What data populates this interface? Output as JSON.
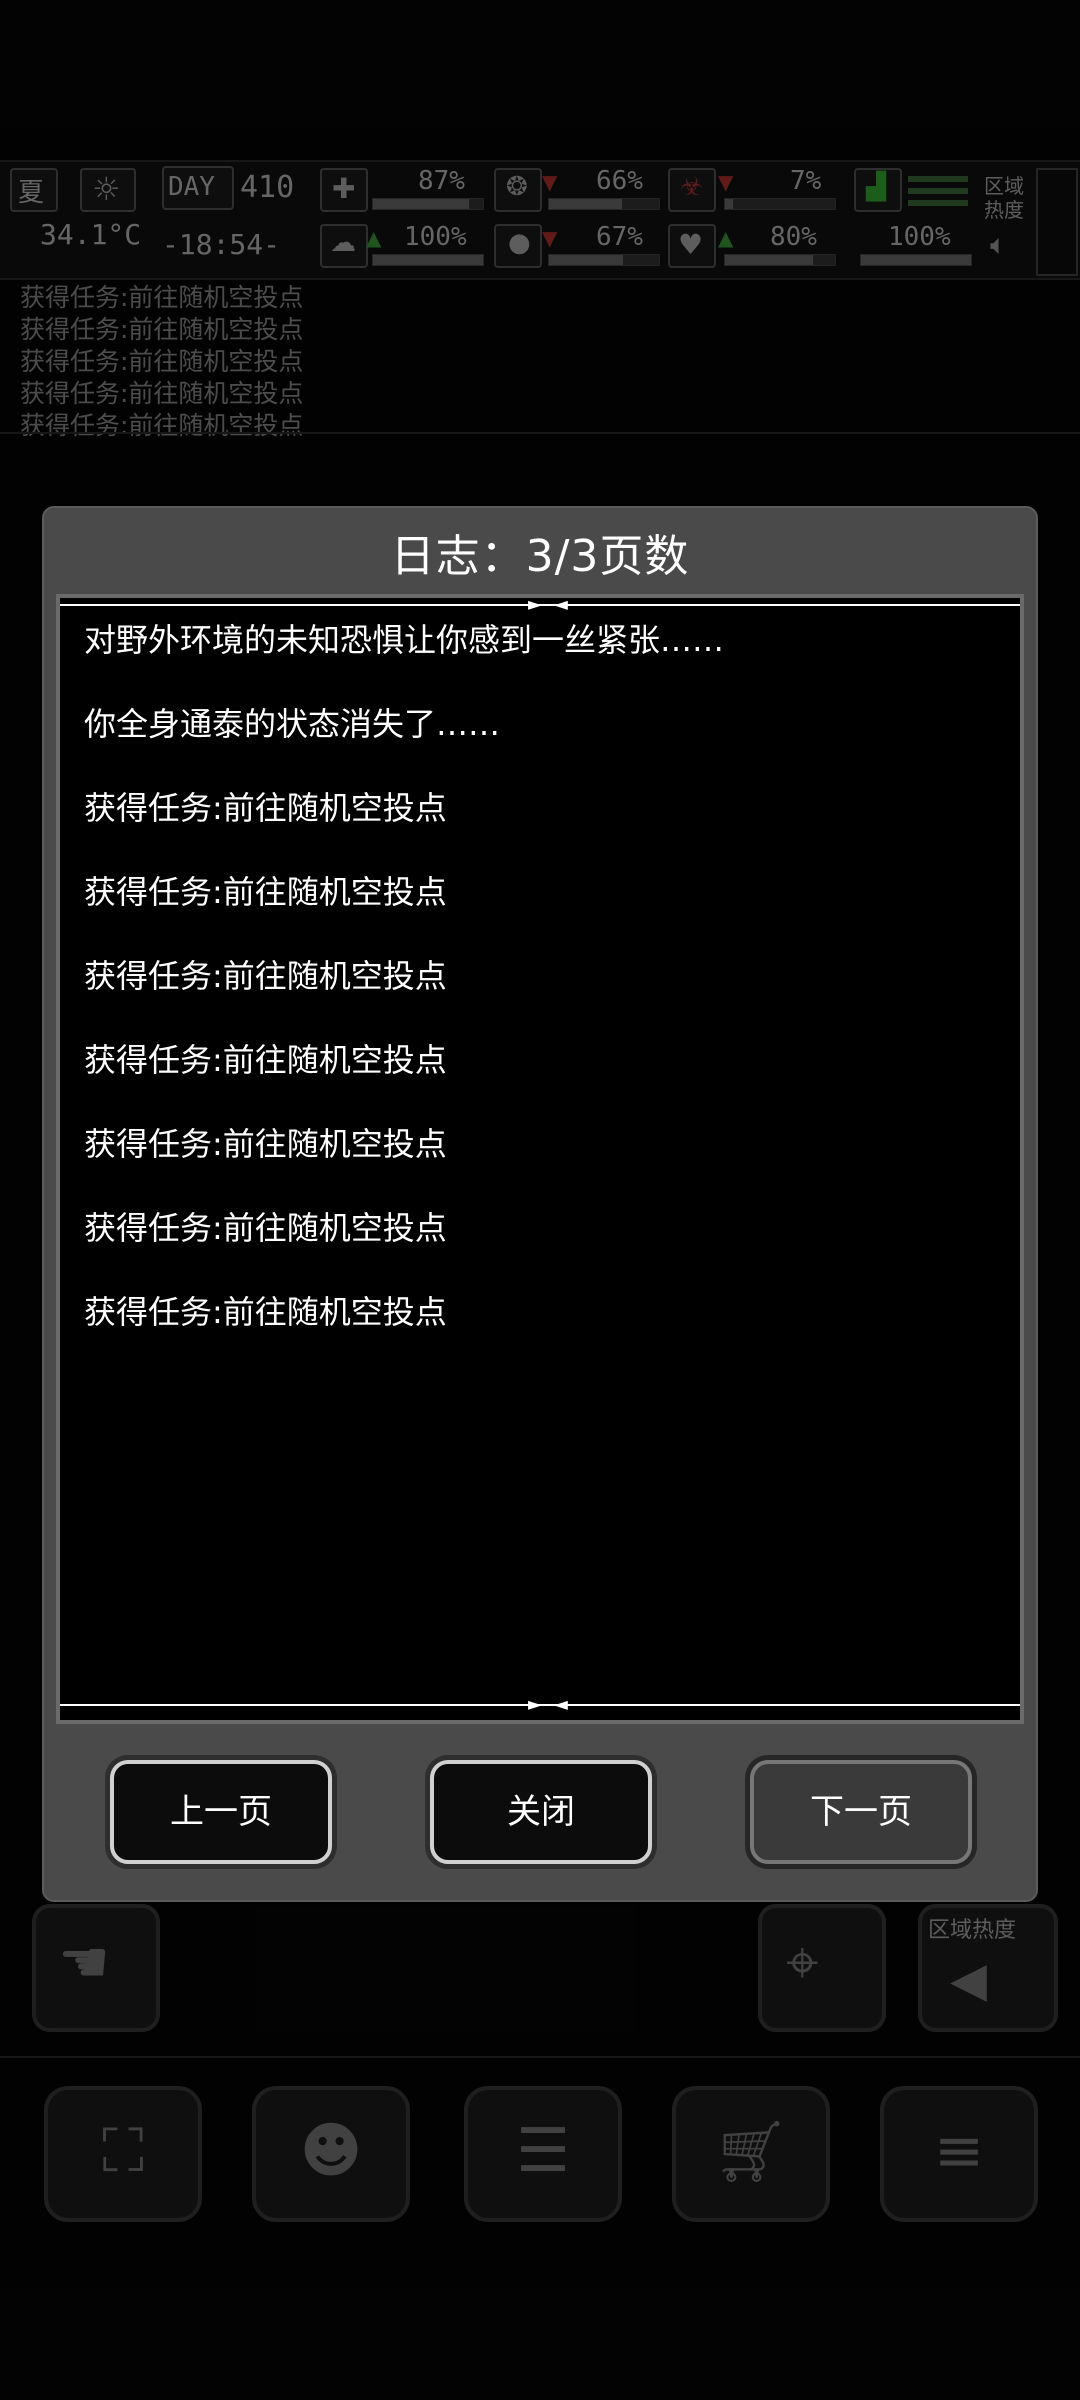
{
  "hud": {
    "season": "夏",
    "day_label": "DAY",
    "day_number": "410",
    "temperature": "34.1°C",
    "time": "-18:54-",
    "stats": [
      "87%",
      "66%",
      "7%",
      "100%",
      "67%",
      "80%",
      "100%"
    ],
    "zone_heat_label": "区域\n热度"
  },
  "background_log": [
    "获得任务:前往随机空投点",
    "获得任务:前往随机空投点",
    "获得任务:前往随机空投点",
    "获得任务:前往随机空投点",
    "获得任务:前往随机空投点"
  ],
  "side": {
    "zone_heat_label": "区域热度"
  },
  "dialog": {
    "title": "日志：3/3页数",
    "lines": [
      "对野外环境的未知恐惧让你感到一丝紧张……",
      "你全身通泰的状态消失了……",
      "获得任务:前往随机空投点",
      "获得任务:前往随机空投点",
      "获得任务:前往随机空投点",
      "获得任务:前往随机空投点",
      "获得任务:前往随机空投点",
      "获得任务:前往随机空投点",
      "获得任务:前往随机空投点"
    ],
    "buttons": {
      "prev": "上一页",
      "close": "关闭",
      "next": "下一页"
    }
  },
  "icons": {
    "bottom_nav": [
      "backpack-icon",
      "brain-icon",
      "notebook-icon",
      "cart-icon",
      "menu-icon"
    ]
  }
}
